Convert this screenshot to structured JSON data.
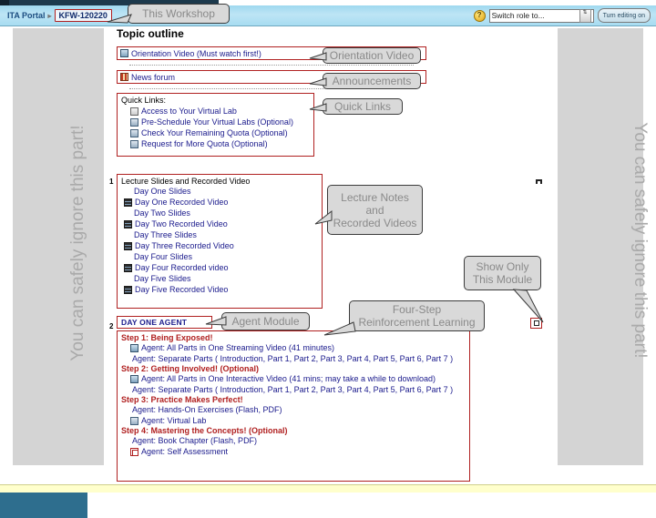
{
  "header": {
    "breadcrumb_root": "ITA Portal",
    "breadcrumb_sep": "▸",
    "breadcrumb_current": "KFW-120220",
    "help_icon_label": "?",
    "role_select_value": "Switch role to...",
    "role_select_arrow": "⇅",
    "edit_button": "Turn editing on"
  },
  "sidebars": {
    "left_note": "You can safely ignore this part!",
    "right_note": "You can safely ignore this part!"
  },
  "main": {
    "title": "Topic outline",
    "section0": {
      "orientation_video": "Orientation Video (Must watch first!)",
      "news_forum": "News forum",
      "quick_links_title": "Quick Links:",
      "quick_links": [
        "Access to Your Virtual Lab",
        "Pre-Schedule Your Virtual Labs (Optional)",
        "Check Your Remaining Quota (Optional)",
        "Request for More Quota (Optional)"
      ]
    },
    "section1": {
      "number": "1",
      "heading": "Lecture Slides and Recorded Video",
      "items": [
        "Day One Slides",
        "Day One Recorded Video",
        "Day Two Slides",
        "Day Two Recorded Video",
        "Day Three Slides",
        "Day Three Recorded Video",
        "Day Four Slides",
        "Day Four Recorded video",
        "Day Five Slides",
        "Day Five Recorded Video"
      ]
    },
    "section2": {
      "number": "2",
      "heading": "DAY ONE AGENT",
      "steps": [
        {
          "title": "Step 1: Being Exposed!",
          "items": [
            "Agent: All Parts in One Streaming Video (41 minutes)",
            "Agent: Separate Parts ( Introduction, Part 1, Part 2, Part 3, Part 4, Part 5, Part 6, Part 7 )"
          ]
        },
        {
          "title": "Step 2: Getting Involved! (Optional)",
          "items": [
            "Agent: All Parts in One Interactive Video (41 mins; may take a while to download)",
            "Agent: Separate Parts ( Introduction, Part 1, Part 2, Part 3, Part 4, Part 5, Part 6, Part 7 )"
          ]
        },
        {
          "title": "Step 3: Practice Makes Perfect!",
          "items": [
            "Agent: Hands-On Exercises (Flash, PDF)",
            "Agent: Virtual Lab"
          ]
        },
        {
          "title": "Step 4: Mastering the Concepts! (Optional)",
          "items": [
            "Agent: Book Chapter (Flash, PDF)",
            "Agent: Self Assessment"
          ]
        }
      ]
    }
  },
  "callouts": {
    "this_workshop": "This Workshop",
    "orientation_video": "Orientation Video",
    "announcements": "Announcements",
    "quick_links": "Quick Links",
    "lecture_notes_l1": "Lecture Notes",
    "lecture_notes_l2": "and",
    "lecture_notes_l3": "Recorded Videos",
    "show_only_l1": "Show Only",
    "show_only_l2": "This Module",
    "agent_module": "Agent Module",
    "four_step_l1": "Four-Step",
    "four_step_l2": "Reinforcement Learning"
  }
}
